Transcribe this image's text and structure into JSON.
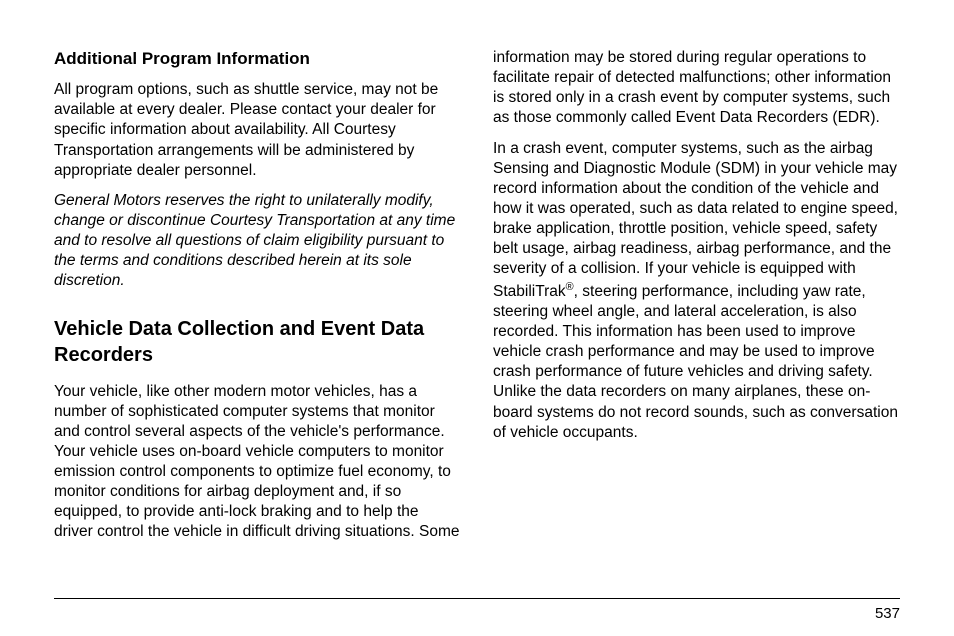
{
  "leftColumn": {
    "heading1": "Additional Program Information",
    "para1": "All program options, such as shuttle service, may not be available at every dealer. Please contact your dealer for specific information about availability. All Courtesy Transportation arrangements will be administered by appropriate dealer personnel.",
    "para2": "General Motors reserves the right to unilaterally modify, change or discontinue Courtesy Transportation at any time and to resolve all questions of claim eligibility pursuant to the terms and conditions described herein at its sole discretion.",
    "heading2": "Vehicle Data Collection and Event Data Recorders",
    "para3": "Your vehicle, like other modern motor vehicles, has a number of sophisticated computer systems that monitor and control several aspects of the vehicle's performance. Your vehicle uses on-board vehicle computers to monitor emission control components to optimize fuel economy, to monitor conditions for airbag deployment and, if so equipped, to provide anti-lock braking and to help the driver control the vehicle in difficult driving situations. Some"
  },
  "rightColumn": {
    "para1": "information may be stored during regular operations to facilitate repair of detected malfunctions; other information is stored only in a crash event by computer systems, such as those commonly called Event Data Recorders (EDR).",
    "para2a": "In a crash event, computer systems, such as the airbag Sensing and Diagnostic Module (SDM) in your vehicle may record information about the condition of the vehicle and how it was operated, such as data related to engine speed, brake application, throttle position, vehicle speed, safety belt usage, airbag readiness, airbag performance, and the severity of a collision. If your vehicle is equipped with StabiliTrak",
    "para2sup": "®",
    "para2b": ", steering performance, including yaw rate, steering wheel angle, and lateral acceleration, is also recorded. This information has been used to improve vehicle crash performance and may be used to improve crash performance of future vehicles and driving safety. Unlike the data recorders on many airplanes, these on-board systems do not record sounds, such as conversation of vehicle occupants."
  },
  "pageNumber": "537"
}
